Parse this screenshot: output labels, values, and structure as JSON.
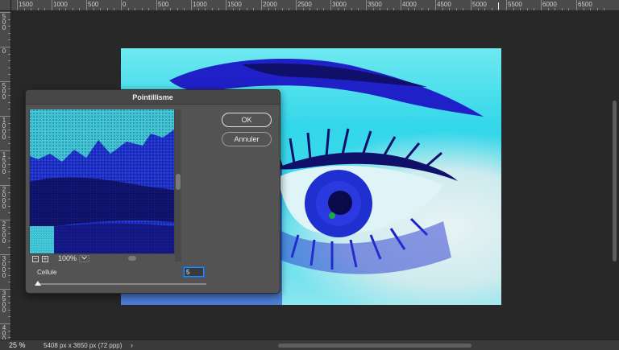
{
  "dialog": {
    "title": "Pointillisme",
    "ok_label": "OK",
    "cancel_label": "Annuler",
    "zoom_percent": "100%",
    "zoom_out_symbol": "−",
    "zoom_in_symbol": "+",
    "dropdown_icon": "chevron-down-icon",
    "cellule_label": "Cellule",
    "cellule_value": "5",
    "slider_fraction": 0.0
  },
  "rulers": {
    "top_labels": [
      "1500",
      "1000",
      "500",
      "0",
      "500",
      "1000",
      "1500",
      "2000",
      "2500",
      "3000",
      "3500",
      "4000",
      "4500",
      "5000",
      "5500",
      "6000",
      "6500"
    ],
    "left_labels": [
      "500",
      "0",
      "500",
      "1000",
      "1500",
      "2000",
      "2500",
      "3000",
      "3500",
      "4000"
    ]
  },
  "status": {
    "zoom": "25 %",
    "doc_info": "5408 px x 3650 px (72 ppp)",
    "chevron": "›"
  },
  "colors": {
    "cyan": "#33d7ea",
    "blue": "#1f2fd0",
    "navy": "#10106a",
    "background": "#282828",
    "accent": "#1a8cff"
  }
}
